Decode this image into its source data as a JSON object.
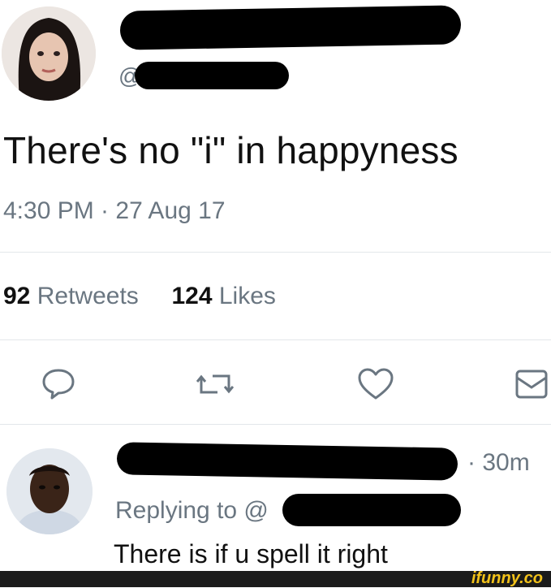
{
  "tweet": {
    "handle_prefix": "@",
    "text": "There's no \"i\" in happyness",
    "timestamp": "4:30 PM · 27 Aug 17",
    "retweets_count": "92",
    "retweets_label": "Retweets",
    "likes_count": "124",
    "likes_label": "Likes"
  },
  "actions": {
    "reply_icon": "reply-icon",
    "retweet_icon": "retweet-icon",
    "like_icon": "heart-icon",
    "dm_icon": "mail-icon"
  },
  "reply": {
    "time": "· 30m",
    "replying_to_label": "Replying to @",
    "text": "There is if u spell it right"
  },
  "footer": {
    "watermark": "ifunny.co"
  },
  "colors": {
    "muted_text": "#6a7681",
    "redaction": "#000000",
    "watermark": "#f2c21a"
  }
}
